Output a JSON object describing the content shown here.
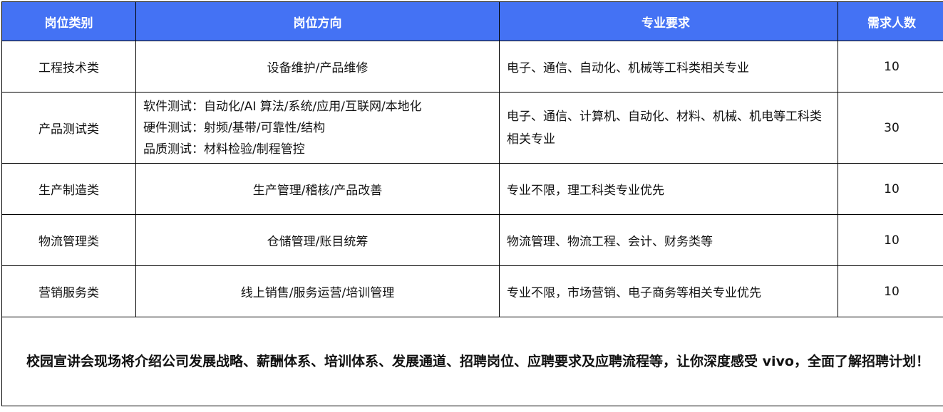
{
  "table": {
    "headers": [
      "岗位类别",
      "岗位方向",
      "专业要求",
      "需求人数"
    ],
    "rows": [
      {
        "category": "工程技术类",
        "direction": "设备维护/产品维修",
        "major": "电子、通信、自动化、机械等工科类相关专业",
        "count": "10"
      },
      {
        "category": "产品测试类",
        "direction_lines": [
          "软件测试：自动化/AI 算法/系统/应用/互联网/本地化",
          "硬件测试：射频/基带/可靠性/结构",
          "品质测试：材料检验/制程管控"
        ],
        "major": "电子、通信、计算机、自动化、材料、机械、机电等工科类相关专业",
        "count": "30"
      },
      {
        "category": "生产制造类",
        "direction": "生产管理/稽核/产品改善",
        "major": "专业不限，理工科类专业优先",
        "count": "10"
      },
      {
        "category": "物流管理类",
        "direction": "仓储管理/账目统筹",
        "major": "物流管理、物流工程、会计、财务类等",
        "count": "10"
      },
      {
        "category": "营销服务类",
        "direction": "线上销售/服务运营/培训管理",
        "major": "专业不限，市场营销、电子商务等相关专业优先",
        "count": "10"
      }
    ]
  },
  "note": "校园宣讲会现场将介绍公司发展战略、薪酬体系、培训体系、发展通道、招聘岗位、应聘要求及应聘流程等，让你深度感受 vivo，全面了解招聘计划！",
  "colors": {
    "header_bg": "#4472f4",
    "header_text": "#ffffff",
    "border": "#000000",
    "spellcheck_underline": "#2ea34a"
  }
}
